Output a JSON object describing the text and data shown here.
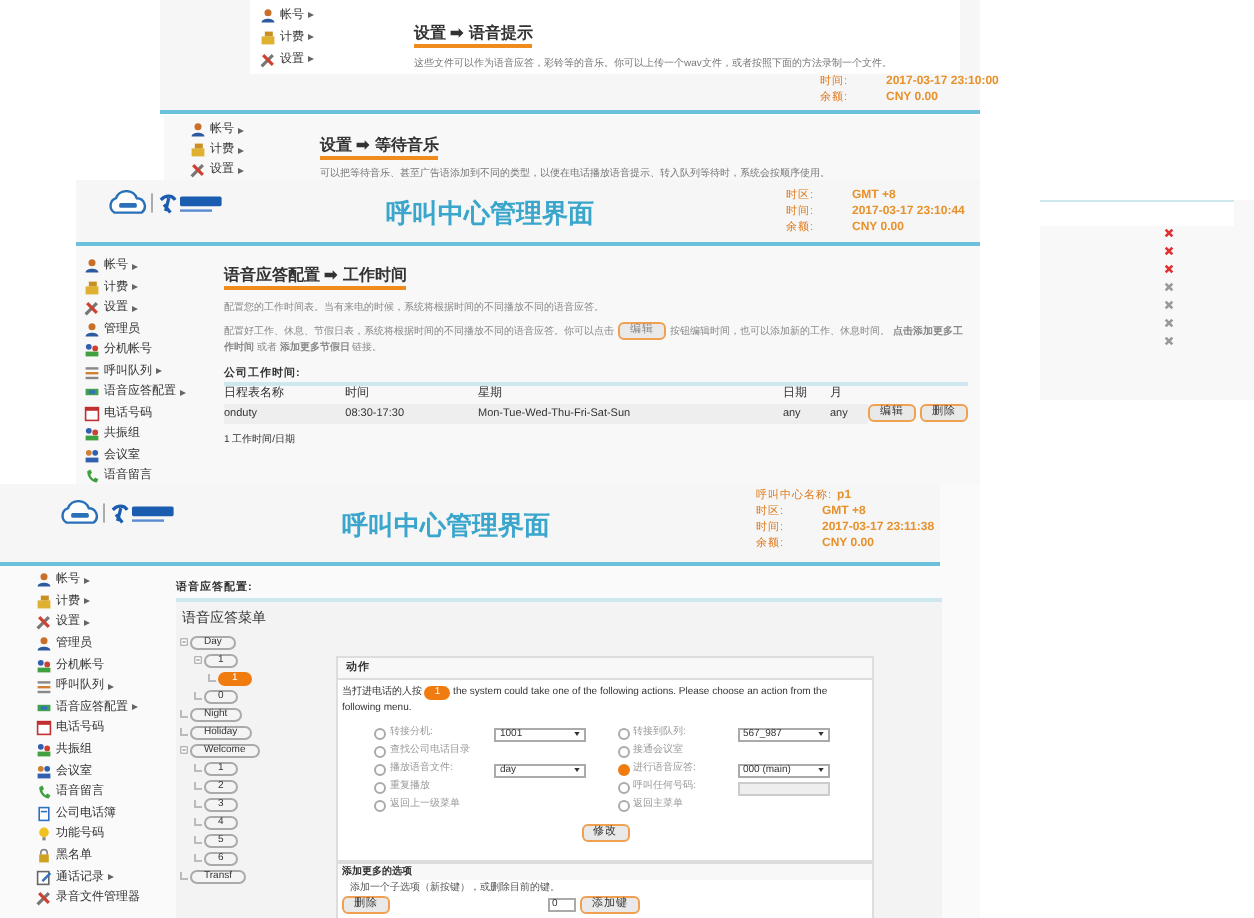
{
  "voice_prompt_page": {
    "sidebar": [
      {
        "label": "帐号",
        "expandable": true
      },
      {
        "label": "计费",
        "expandable": true
      },
      {
        "label": "设置",
        "expandable": true
      }
    ],
    "header_info": [
      {
        "label": "时间:",
        "value": "2017-03-17 23:10:00"
      },
      {
        "label": "余额:",
        "value": "CNY 0.00"
      }
    ],
    "title": "设置 ➡ 语音提示",
    "description": "这些文件可以作为语音应答，彩铃等的音乐。你可以上传一个wav文件，或者按照下面的方法录制一个文件。"
  },
  "hold_music_page": {
    "sidebar": [
      {
        "label": "帐号",
        "expandable": true
      },
      {
        "label": "计费",
        "expandable": true
      },
      {
        "label": "设置",
        "expandable": true
      }
    ],
    "title": "设置 ➡ 等待音乐",
    "description": "可以把等待音乐、甚至广告语添加到不同的类型，以便在电话播放语音提示、转入队列等待时，系统会按顺序使用。"
  },
  "work_time_page": {
    "header_title": "呼叫中心管理界面",
    "header_info": [
      {
        "label": "时区:",
        "value": "GMT +8"
      },
      {
        "label": "时间:",
        "value": "2017-03-17 23:10:44"
      },
      {
        "label": "余额:",
        "value": "CNY 0.00"
      }
    ],
    "sidebar": [
      {
        "label": "帐号",
        "expandable": true
      },
      {
        "label": "计费",
        "expandable": true
      },
      {
        "label": "设置",
        "expandable": true
      },
      {
        "label": "管理员",
        "expandable": false
      },
      {
        "label": "分机帐号",
        "expandable": false
      },
      {
        "label": "呼叫队列",
        "expandable": true
      },
      {
        "label": "语音应答配置",
        "expandable": true
      },
      {
        "label": "电话号码",
        "expandable": false
      },
      {
        "label": "共振组",
        "expandable": false
      },
      {
        "label": "会议室",
        "expandable": false
      },
      {
        "label": "语音留言",
        "expandable": false
      }
    ],
    "title": "语音应答配置 ➡ 工作时间",
    "description": "配置您的工作时间表。当有来电的时候，系统将根据时间的不同播放不同的语音应答。",
    "instructions": {
      "before": "配置好工作、休息、节假日表，系统将根据时间的不同播放不同的语音应答。你可以点击",
      "button": "编辑",
      "after": "按钮编辑时间，也可以添加新的工作、休息时间。 **点击添加更多工作时间** 或者 **添加更多节假日** 链接。"
    },
    "table_title": "公司工作时间:",
    "table": {
      "columns": [
        "日程表名称",
        "时间",
        "星期",
        "日期",
        "月"
      ],
      "rows": [
        {
          "cells": [
            "onduty",
            "08:30-17:30",
            "Mon-Tue-Wed-Thu-Fri-Sat-Sun",
            "any",
            "any"
          ],
          "buttons": [
            "编辑",
            "删除"
          ]
        }
      ]
    },
    "footer": "1 工作时间/日期"
  },
  "side_panel": {
    "delete_marks": [
      {
        "active": true
      },
      {
        "active": true
      },
      {
        "active": true
      },
      {
        "active": false
      },
      {
        "active": false
      },
      {
        "active": false
      },
      {
        "active": false
      }
    ]
  },
  "ivr_page": {
    "header_title": "呼叫中心管理界面",
    "header_info": [
      {
        "label": "呼叫中心名称:",
        "value": "p1"
      },
      {
        "label": "时区:",
        "value": "GMT +8"
      },
      {
        "label": "时间:",
        "value": "2017-03-17 23:11:38"
      },
      {
        "label": "余额:",
        "value": "CNY 0.00"
      }
    ],
    "sidebar": [
      {
        "label": "帐号",
        "expandable": true
      },
      {
        "label": "计费",
        "expandable": true
      },
      {
        "label": "设置",
        "expandable": true
      },
      {
        "label": "管理员",
        "expandable": false
      },
      {
        "label": "分机帐号",
        "expandable": false
      },
      {
        "label": "呼叫队列",
        "expandable": true
      },
      {
        "label": "语音应答配置",
        "expandable": true
      },
      {
        "label": "电话号码",
        "expandable": false
      },
      {
        "label": "共振组",
        "expandable": false
      },
      {
        "label": "会议室",
        "expandable": false
      },
      {
        "label": "语音留言",
        "expandable": false
      },
      {
        "label": "公司电话簿",
        "expandable": false
      },
      {
        "label": "功能号码",
        "expandable": false
      },
      {
        "label": "黑名单",
        "expandable": false
      },
      {
        "label": "通话记录",
        "expandable": true
      },
      {
        "label": "录音文件管理器",
        "expandable": false
      }
    ],
    "section_label": "语音应答配置:",
    "menu_title": "语音应答菜单",
    "tree": [
      {
        "label": "Day",
        "selected": false,
        "children": [
          {
            "label": "1",
            "selected": false,
            "children": [
              {
                "label": "1",
                "selected": true
              }
            ]
          },
          {
            "label": "0",
            "selected": false
          }
        ]
      },
      {
        "label": "Night",
        "selected": false
      },
      {
        "label": "Holiday",
        "selected": false
      },
      {
        "label": "Welcome",
        "selected": false,
        "children": [
          {
            "label": "1",
            "selected": false
          },
          {
            "label": "2",
            "selected": false
          },
          {
            "label": "3",
            "selected": false
          },
          {
            "label": "4",
            "selected": false
          },
          {
            "label": "5",
            "selected": false
          },
          {
            "label": "6",
            "selected": false
          }
        ]
      },
      {
        "label": "Transf",
        "selected": false
      }
    ],
    "action": {
      "title": "动作",
      "prompt_before": "当打进电话的人按",
      "key": "1",
      "prompt_after": "the system could take one of the following actions. Please choose an action from the following menu.",
      "options": [
        {
          "label": "转接分机:",
          "selected": false,
          "control": {
            "kind": "select",
            "value": "1001"
          }
        },
        {
          "label": "转接到队列:",
          "selected": false,
          "control": {
            "kind": "select",
            "value": "567_987"
          }
        },
        {
          "label": "查找公司电话目录",
          "selected": false
        },
        {
          "label": "接通会议室",
          "selected": false
        },
        {
          "label": "播放语音文件:",
          "selected": false,
          "control": {
            "kind": "select",
            "value": "day"
          }
        },
        {
          "label": "进行语音应答:",
          "selected": true,
          "control": {
            "kind": "select",
            "value": "000 (main)"
          }
        },
        {
          "label": "重复播放",
          "selected": false
        },
        {
          "label": "呼叫任何号码:",
          "selected": false,
          "control": {
            "kind": "input"
          }
        },
        {
          "label": "返回上一级菜单",
          "selected": false
        },
        {
          "label": "返回主菜单",
          "selected": false
        }
      ],
      "submit": "修改"
    },
    "more": {
      "title": "添加更多的选项",
      "hint": "添加一个子选项（新按键），或删除目前的键。",
      "delete_button": "删除",
      "key_select": "0",
      "add_button": "添加键"
    }
  }
}
